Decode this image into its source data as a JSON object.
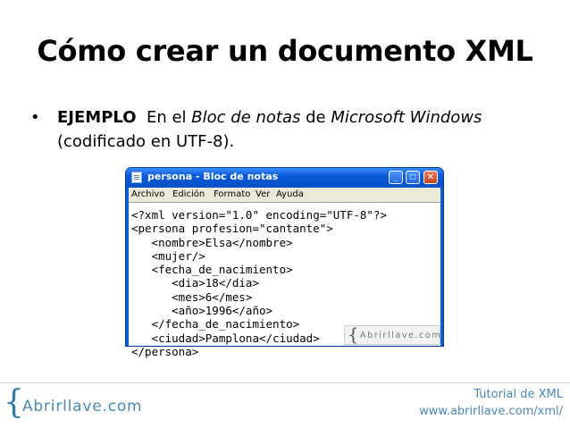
{
  "slide": {
    "title": "Cómo crear un documento XML",
    "bullet_symbol": "•",
    "bullet": {
      "label": "EJEMPLO",
      "t1": "  En el ",
      "app": "Bloc de notas",
      "t2": " de ",
      "os": "Microsoft Windows",
      "t3": " (codificado en UTF-8)."
    }
  },
  "window": {
    "title": "persona - Bloc de notas",
    "buttons": {
      "minimize": "_",
      "maximize": "□",
      "close": "✕"
    },
    "menu": [
      "Archivo",
      "Edición",
      "Formato",
      "Ver",
      "Ayuda"
    ],
    "code": "<?xml version=\"1.0\" encoding=\"UTF-8\"?>\n<persona profesion=\"cantante\">\n   <nombre>Elsa</nombre>\n   <mujer/>\n   <fecha_de_nacimiento>\n      <dia>18</dia>\n      <mes>6</mes>\n      <año>1996</año>\n   </fecha_de_nacimiento>\n   <ciudad>Pamplona</ciudad>\n</persona>",
    "watermark": {
      "brace": "{",
      "text": "Abrirllave.com"
    }
  },
  "footer": {
    "logo_brace": "{",
    "logo_text": "Abrirllave.com",
    "line1": "Tutorial de XML",
    "line2": "www.abrirllave.com/xml/"
  },
  "icons": {
    "app": "notepad-icon",
    "logo": "brace-logo-icon"
  },
  "colors": {
    "titlebar": "#0a5bd9",
    "menubar": "#ece9d8",
    "close": "#c9411d",
    "brand": "#4a88b3"
  }
}
